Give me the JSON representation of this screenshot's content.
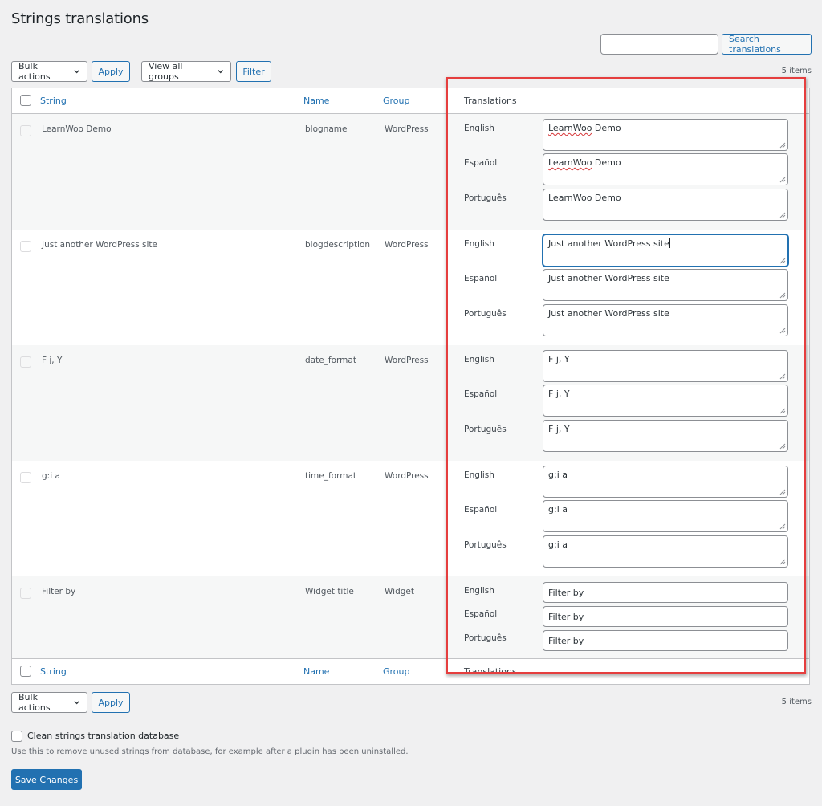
{
  "page": {
    "title": "Strings translations"
  },
  "search": {
    "placeholder": "",
    "value": "",
    "button_label": "Search translations"
  },
  "top_controls": {
    "bulk_actions": "Bulk actions",
    "apply_label": "Apply",
    "group_select": "View all groups",
    "filter_label": "Filter",
    "items_count": "5 items"
  },
  "table": {
    "columns": {
      "string": "String",
      "name": "Name",
      "group": "Group",
      "translations": "Translations"
    },
    "rows": [
      {
        "string": "LearnWoo Demo",
        "name": "blogname",
        "group": "WordPress",
        "translations": [
          {
            "lang": "English",
            "value": "LearnWoo Demo"
          },
          {
            "lang": "Español",
            "value": "LearnWoo Demo"
          },
          {
            "lang": "Português",
            "value": "LearnWoo Demo"
          }
        ]
      },
      {
        "string": "Just another WordPress site",
        "name": "blogdescription",
        "group": "WordPress",
        "translations": [
          {
            "lang": "English",
            "value": "Just another WordPress site"
          },
          {
            "lang": "Español",
            "value": "Just another WordPress site"
          },
          {
            "lang": "Português",
            "value": "Just another WordPress site"
          }
        ]
      },
      {
        "string": "F j, Y",
        "name": "date_format",
        "group": "WordPress",
        "translations": [
          {
            "lang": "English",
            "value": "F j, Y"
          },
          {
            "lang": "Español",
            "value": "F j, Y"
          },
          {
            "lang": "Português",
            "value": "F j, Y"
          }
        ]
      },
      {
        "string": "g:i a",
        "name": "time_format",
        "group": "WordPress",
        "translations": [
          {
            "lang": "English",
            "value": "g:i a"
          },
          {
            "lang": "Español",
            "value": "g:i a"
          },
          {
            "lang": "Português",
            "value": "g:i a"
          }
        ]
      },
      {
        "string": "Filter by",
        "name": "Widget title",
        "group": "Widget",
        "translations": [
          {
            "lang": "English",
            "value": "Filter by"
          },
          {
            "lang": "Español",
            "value": "Filter by"
          },
          {
            "lang": "Português",
            "value": "Filter by"
          }
        ]
      }
    ]
  },
  "bottom_controls": {
    "bulk_actions": "Bulk actions",
    "apply_label": "Apply",
    "items_count": "5 items"
  },
  "clean_db": {
    "label": "Clean strings translation database",
    "description": "Use this to remove unused strings from database, for example after a plugin has been uninstalled."
  },
  "save_label": "Save Changes",
  "colors": {
    "accent": "#2271b1",
    "highlight": "#e53e3e",
    "background": "#f0f0f1"
  }
}
